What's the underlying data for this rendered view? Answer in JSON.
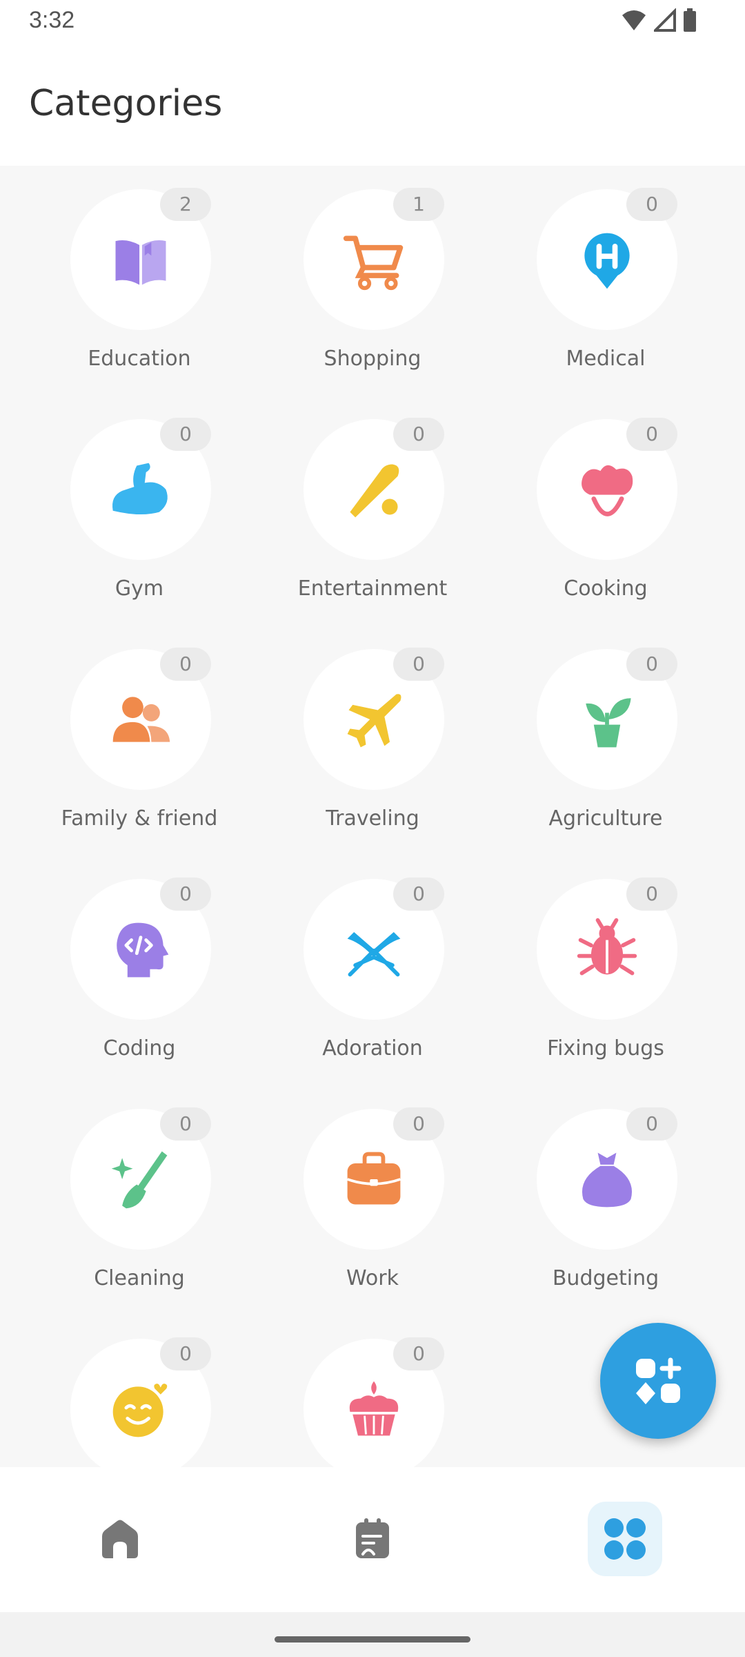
{
  "status_bar": {
    "time": "3:32"
  },
  "header": {
    "title": "Categories"
  },
  "categories": [
    {
      "label": "Education",
      "count": "2",
      "icon": "book-icon",
      "color": "#9b7fe6"
    },
    {
      "label": "Shopping",
      "count": "1",
      "icon": "cart-icon",
      "color": "#f08a4b"
    },
    {
      "label": "Medical",
      "count": "0",
      "icon": "hospital-pin-icon",
      "color": "#1fa8e6"
    },
    {
      "label": "Gym",
      "count": "0",
      "icon": "muscle-icon",
      "color": "#3ab5ef"
    },
    {
      "label": "Entertainment",
      "count": "0",
      "icon": "baseball-bat-icon",
      "color": "#f2c530"
    },
    {
      "label": "Cooking",
      "count": "0",
      "icon": "chef-hat-icon",
      "color": "#f06b84"
    },
    {
      "label": "Family & friend",
      "count": "0",
      "icon": "people-icon",
      "color": "#f08a4b"
    },
    {
      "label": "Traveling",
      "count": "0",
      "icon": "airplane-icon",
      "color": "#f2c530"
    },
    {
      "label": "Agriculture",
      "count": "0",
      "icon": "plant-icon",
      "color": "#5cc28a"
    },
    {
      "label": "Coding",
      "count": "0",
      "icon": "code-head-icon",
      "color": "#9b7fe6"
    },
    {
      "label": "Adoration",
      "count": "0",
      "icon": "open-book-icon",
      "color": "#1fa8e6"
    },
    {
      "label": "Fixing bugs",
      "count": "0",
      "icon": "bug-icon",
      "color": "#f06b84"
    },
    {
      "label": "Cleaning",
      "count": "0",
      "icon": "broom-icon",
      "color": "#5cc28a"
    },
    {
      "label": "Work",
      "count": "0",
      "icon": "briefcase-icon",
      "color": "#f08a4b"
    },
    {
      "label": "Budgeting",
      "count": "0",
      "icon": "money-bag-icon",
      "color": "#9b7fe6"
    },
    {
      "label": "",
      "count": "0",
      "icon": "smile-heart-icon",
      "color": "#f2c530"
    },
    {
      "label": "",
      "count": "0",
      "icon": "cupcake-icon",
      "color": "#f06b84"
    }
  ],
  "fab": {
    "icon": "add-category-icon",
    "color": "#2e9fe0"
  },
  "bottom_nav": {
    "items": [
      {
        "name": "home",
        "icon": "home-icon",
        "active": false
      },
      {
        "name": "notes",
        "icon": "notes-icon",
        "active": false
      },
      {
        "name": "categories",
        "icon": "grid-icon",
        "active": true
      }
    ]
  }
}
